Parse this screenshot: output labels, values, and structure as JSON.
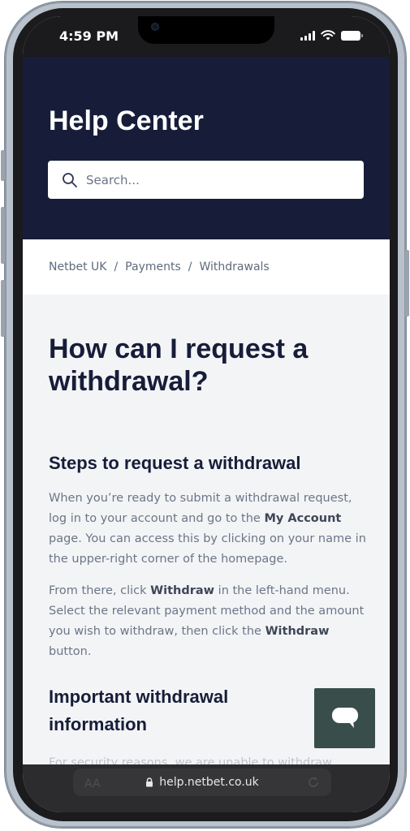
{
  "status_bar": {
    "time": "4:59 PM"
  },
  "header": {
    "title": "Help Center"
  },
  "search": {
    "placeholder": "Search...",
    "icon": "search-icon"
  },
  "breadcrumb": {
    "items": [
      "Netbet UK",
      "Payments",
      "Withdrawals"
    ],
    "separator": "/"
  },
  "article": {
    "title": "How can I request a withdrawal?",
    "section1_heading": "Steps to request a withdrawal",
    "para1_before": "When you’re ready to submit a withdrawal request, log in to your account and go to the ",
    "para1_bold": "My Account",
    "para1_after": " page. You can access this by clicking on your name in the upper-right corner of the homepage.",
    "para2_part1": "From there, click ",
    "para2_bold1": "Withdraw",
    "para2_part2": " in the left-hand menu. Select the relevant payment method and the amount you wish to withdraw, then click the ",
    "para2_bold2": "Withdraw",
    "para2_part3": " button.",
    "section2_heading": "Important withdrawal information",
    "faded_text": "For security reasons, we are unable to withdraw"
  },
  "chat": {
    "icon": "chat-bubble-icon"
  },
  "browser": {
    "aa_label": "AA",
    "url": "help.netbet.co.uk"
  },
  "colors": {
    "header_bg": "#171d39",
    "page_bg": "#f3f4f6",
    "chat_bg": "#394e4a",
    "heading_text": "#171d39",
    "body_text": "#6c7587"
  }
}
